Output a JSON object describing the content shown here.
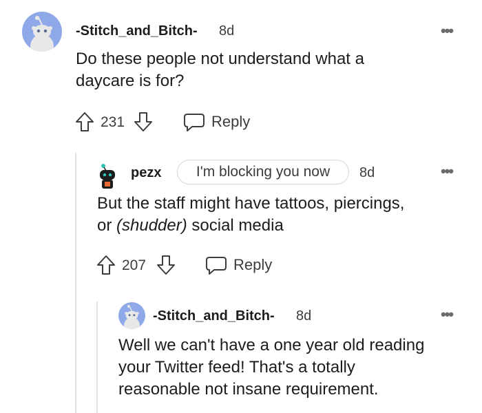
{
  "comments": [
    {
      "username": "-Stitch_and_Bitch-",
      "age": "8d",
      "body_lines": [
        "Do these people not understand what a",
        "daycare is for?"
      ],
      "votes": "231",
      "reply_label": "Reply"
    },
    {
      "username": "pezx",
      "flair": "I'm blocking you now",
      "age": "8d",
      "body_line1": "But the staff might have tattoos, piercings,",
      "body_line2_pre": "or ",
      "body_line2_em": "(shudder)",
      "body_line2_post": " social media",
      "votes": "207",
      "reply_label": "Reply"
    },
    {
      "username": "-Stitch_and_Bitch-",
      "age": "8d",
      "body_lines": [
        "Well we can't have a one year old reading",
        "your Twitter feed! That's a totally",
        "reasonable not insane requirement."
      ]
    }
  ],
  "icons": {
    "more": "more-options-icon",
    "upvote": "upvote-arrow-icon",
    "downvote": "downvote-arrow-icon",
    "reply": "speech-bubble-icon",
    "avatar": "snoo-avatar-icon"
  },
  "colors": {
    "avatar_bg": "#8fa8e8",
    "text": "#1c1c1c",
    "meta": "#3c3c3c"
  }
}
